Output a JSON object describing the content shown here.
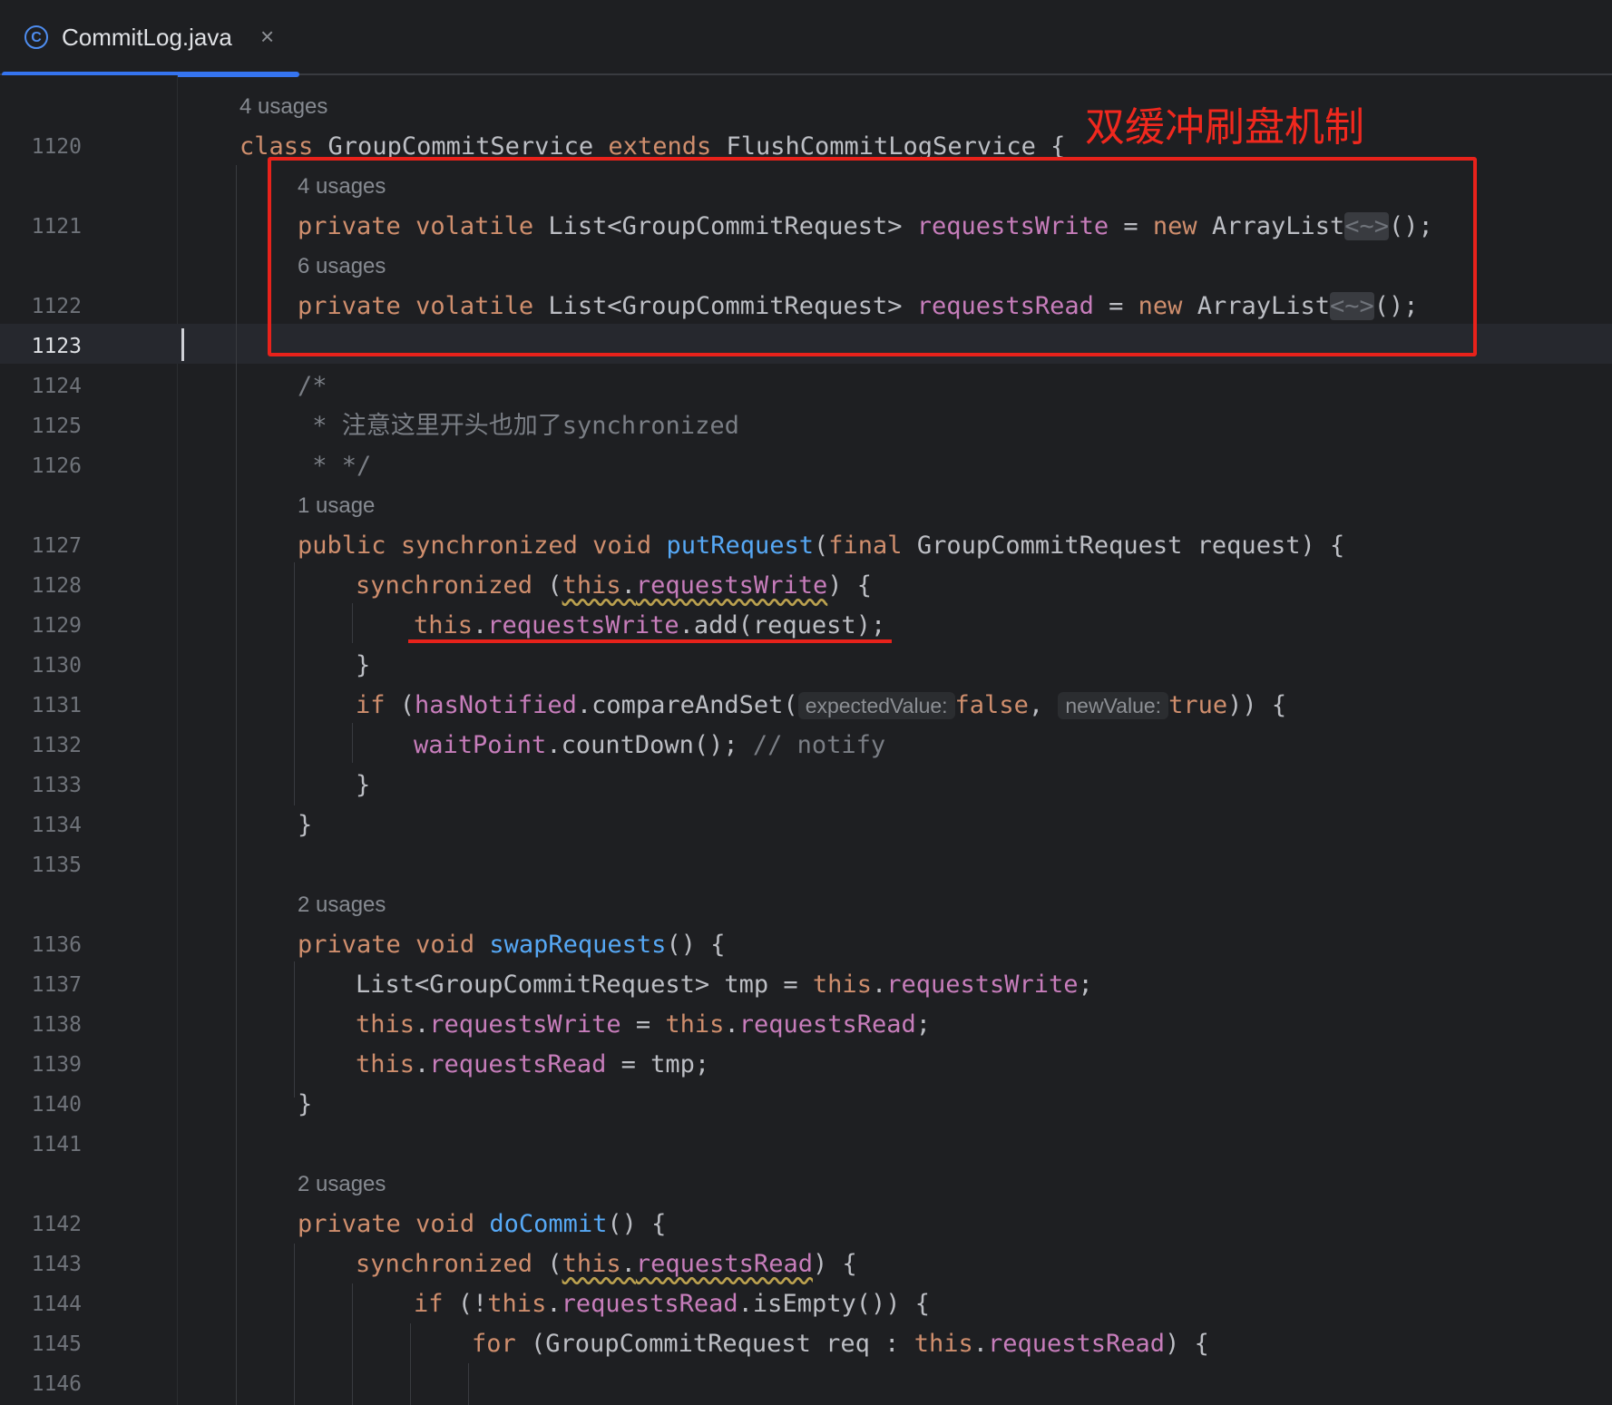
{
  "tab": {
    "title": "CommitLog.java",
    "icon": "C",
    "close": "×"
  },
  "annotation": {
    "label": "双缓冲刷盘机制"
  },
  "hints": {
    "h0": "4 usages",
    "h1": "4 usages",
    "h2": "6 usages",
    "h3": "1 usage",
    "h4": "2 usages",
    "h5": "2 usages"
  },
  "inlays": {
    "expected": "expectedValue:",
    "newvalue": "newValue:"
  },
  "lines": {
    "n1120": "1120",
    "n1121": "1121",
    "n1122": "1122",
    "n1123": "1123",
    "n1124": "1124",
    "n1125": "1125",
    "n1126": "1126",
    "n1127": "1127",
    "n1128": "1128",
    "n1129": "1129",
    "n1130": "1130",
    "n1131": "1131",
    "n1132": "1132",
    "n1133": "1133",
    "n1134": "1134",
    "n1135": "1135",
    "n1136": "1136",
    "n1137": "1137",
    "n1138": "1138",
    "n1139": "1139",
    "n1140": "1140",
    "n1141": "1141",
    "n1142": "1142",
    "n1143": "1143",
    "n1144": "1144",
    "n1145": "1145",
    "n1146": "1146"
  },
  "tokens": {
    "class": "class",
    "groupCommitService": "GroupCommitService",
    "extends": "extends",
    "flushService": "FlushCommitLogService",
    "braceOpen": " {",
    "private": "private",
    "volatile": "volatile",
    "listType": "List<GroupCommitRequest>",
    "requestsWrite": "requestsWrite",
    "requestsRead": "requestsRead",
    "eq": " = ",
    "new": "new",
    "arrayList": "ArrayList",
    "diamond": "<~>",
    "endNew": "();",
    "cOpen": "/*",
    "cLine": " * 注意这里开头也加了synchronized",
    "cClose": " * */",
    "public": "public",
    "synchronized": "synchronized",
    "void": "void",
    "putRequest": "putRequest",
    "final": "final",
    "putParams": " GroupCommitRequest request) {",
    "this": "this",
    "dot": ".",
    "syncOpen": " (",
    "syncClose": ") {",
    "addReq": ".add(request);",
    "closeBrace": "}",
    "if": "if",
    "hasNotified": "hasNotified",
    "compareAndSet": ".compareAndSet(",
    "false": "false",
    "comma": ",",
    "true": "true",
    "ifClose": ")) {",
    "waitPoint": "waitPoint",
    "countDown": ".countDown(); ",
    "notify": "// notify",
    "swapRequests": "swapRequests",
    "parensBrace": "() {",
    "tmpDecl": "List<GroupCommitRequest> tmp = ",
    "semi": ";",
    "tmp": "tmp;",
    "doCommit": "doCommit",
    "ifNot": " (!",
    "isEmpty": ".isEmpty()) {",
    "for": "for",
    "forOpen": " (GroupCommitRequest req : ",
    "forClose": ") {",
    "space": " "
  },
  "colors": {
    "keyword": "#cf8e6d",
    "field": "#c77dbb",
    "method": "#56a8f5",
    "comment": "#7a7e85",
    "text": "#bcbec4",
    "annotation": "#e8221b"
  }
}
